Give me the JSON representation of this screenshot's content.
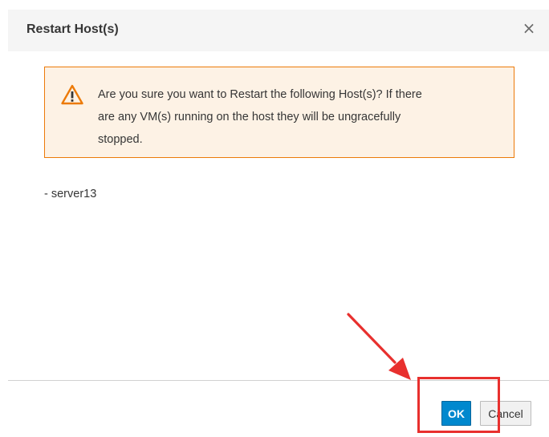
{
  "dialog": {
    "title": "Restart Host(s)",
    "close_glyph": "×",
    "close_icon": "close-icon"
  },
  "warning": {
    "icon": "warning-triangle-icon",
    "line1": "Are you sure you want to Restart the following Host(s)? If there",
    "line2": "are any VM(s) running on the host they will be ungracefully",
    "line3": "stopped."
  },
  "hosts": [
    "- server13"
  ],
  "buttons": {
    "ok_label": "OK",
    "cancel_label": "Cancel"
  },
  "annotation": {
    "arrow_icon": "red-arrow-icon",
    "highlight": "red-highlight-box"
  },
  "colors": {
    "primary": "#0088ce",
    "warning_border": "#ec7a08",
    "warning_bg": "#fdf2e5",
    "annotation": "#e8302e"
  }
}
